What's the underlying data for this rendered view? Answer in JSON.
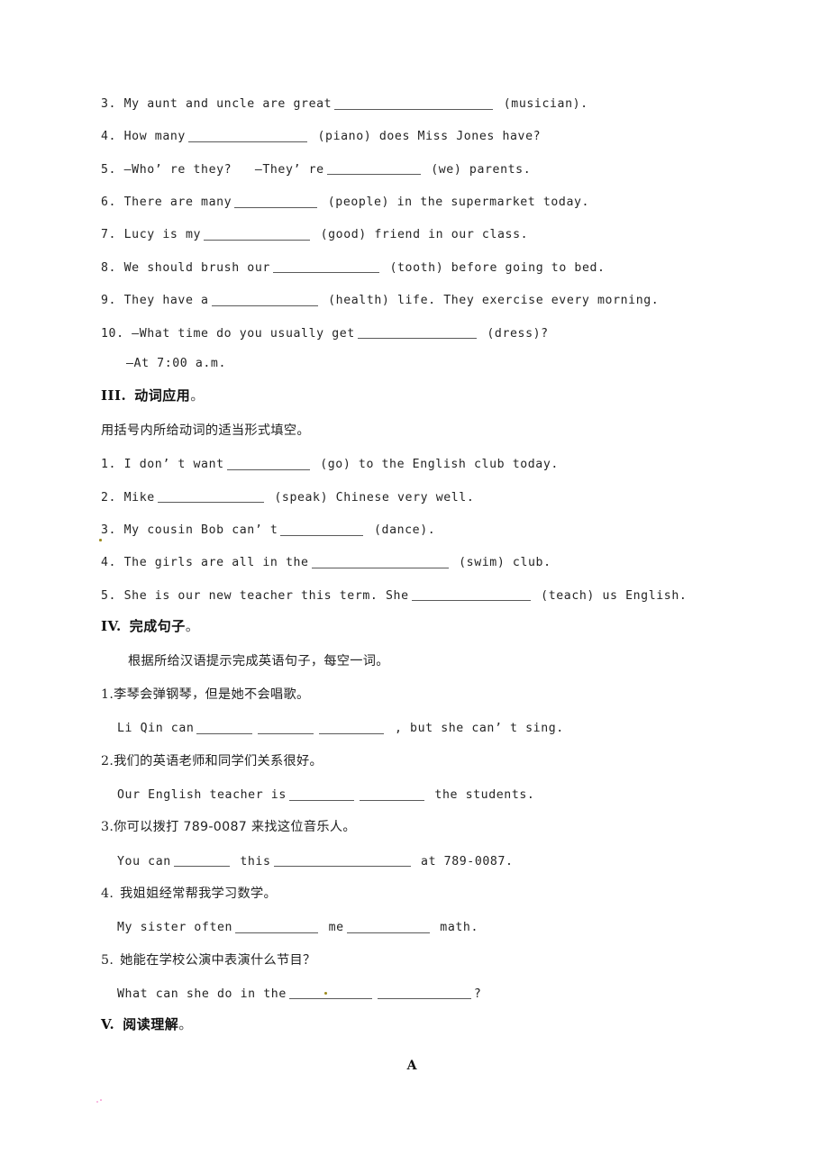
{
  "document": {
    "language_note": "Chinese middle-school English worksheet (scanned)",
    "section2_tail": {
      "items": [
        {
          "number": "3.",
          "pre": "My aunt and uncle are great",
          "blank": "w10",
          "post": "(musician)."
        },
        {
          "number": "4.",
          "pre": "How many",
          "blank": "w8",
          "post": "(piano) does Miss Jones have?"
        },
        {
          "number": "5.",
          "pre": "—Who’ re they?   —They’ re",
          "blank": "w6",
          "post": "(we) parents."
        },
        {
          "number": "6.",
          "pre": "There are many",
          "blank": "w5",
          "post": "(people) in the supermarket today."
        },
        {
          "number": "7.",
          "pre": "Lucy is my",
          "blank": "w7",
          "post": "(good) friend in our class."
        },
        {
          "number": "8.",
          "pre": "We should brush our",
          "blank": "w7",
          "post": "(tooth) before going to bed."
        },
        {
          "number": "9.",
          "pre": "They have a",
          "blank": "w7",
          "post": "(health) life. They exercise every morning."
        },
        {
          "number": "10.",
          "pre": "—What time do you usually get",
          "blank": "w8",
          "post": "(dress)?"
        }
      ],
      "item10_answer": "—At 7:00 a.m."
    },
    "section3": {
      "numeral": "III.",
      "title": "动词应用",
      "title_period": "。",
      "instruction": "用括号内所给动词的适当形式填空。",
      "items": [
        {
          "number": "1.",
          "pre": "I don’ t want",
          "blank": "w5",
          "post": "(go) to the English club today."
        },
        {
          "number": "2.",
          "pre": "Mike",
          "blank": "w7",
          "post": "(speak) Chinese very well."
        },
        {
          "number": "3.",
          "pre": "My cousin Bob can’ t",
          "blank": "w5",
          "post": "(dance)."
        },
        {
          "number": "4.",
          "pre": "The girls are all in the",
          "blank": "w9",
          "post": "(swim) club."
        },
        {
          "number": "5.",
          "pre": "She is our new teacher this term. She",
          "blank": "w8",
          "post": "(teach) us English."
        }
      ]
    },
    "section4": {
      "numeral": "IV.",
      "title": "完成句子",
      "title_period": "。",
      "instruction": "根据所给汉语提示完成英语句子，每空一词。",
      "items": [
        {
          "index": "1.",
          "index_space": false,
          "chinese": "李琴会弹钢琴，但是她不会唱歌。",
          "english_pre": "Li Qin can",
          "blanks": [
            "w2",
            "w2",
            "w3"
          ],
          "english_mid": [],
          "english_post": ", but she can’ t sing."
        },
        {
          "index": "2.",
          "index_space": false,
          "chinese": "我们的英语老师和同学们关系很好。",
          "english_pre": "Our English teacher is",
          "blanks": [
            "w3",
            "w3"
          ],
          "english_mid": [],
          "english_post": "the students."
        },
        {
          "index": "3.",
          "index_space": false,
          "chinese": "你可以拨打 789-0087 来找这位音乐人。",
          "english_pre": "You can",
          "blanks": [
            "w2",
            "w9"
          ],
          "english_mid": [
            "this"
          ],
          "english_post": "at 789-0087."
        },
        {
          "index": "4.",
          "index_space": true,
          "chinese": "我姐姐经常帮我学习数学。",
          "english_pre": "My sister often",
          "blanks": [
            "w5",
            "w5"
          ],
          "english_mid": [
            "me"
          ],
          "english_post": "math."
        },
        {
          "index": "5.",
          "index_space": true,
          "chinese": "她能在学校公演中表演什么节目？",
          "english_pre": "What can she do in the",
          "blanks": [
            "w5",
            "w6"
          ],
          "english_mid": [],
          "english_post": "?"
        }
      ]
    },
    "section5": {
      "numeral": "V.",
      "title": "阅读理解",
      "title_period": "。",
      "passage_label": "A"
    }
  }
}
